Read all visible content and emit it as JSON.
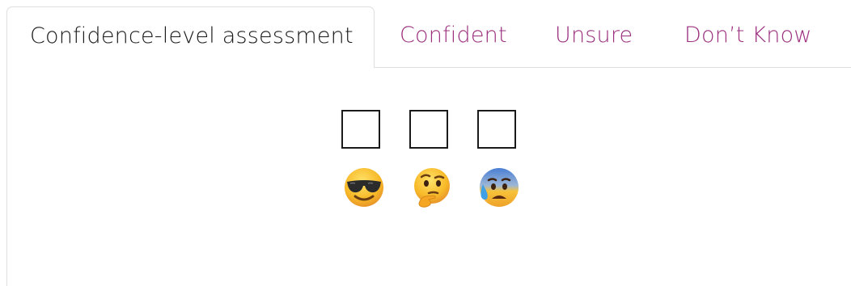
{
  "tabs": {
    "active": "Confidence-level assessment",
    "confident": "Confident",
    "unsure": "Unsure",
    "dont_know": "Don’t Know"
  },
  "options": [
    {
      "key": "confident",
      "checked": false,
      "icon": "smiling-face-with-sunglasses-icon"
    },
    {
      "key": "unsure",
      "checked": false,
      "icon": "thinking-face-icon"
    },
    {
      "key": "dont_know",
      "checked": false,
      "icon": "anxious-face-with-sweat-icon"
    }
  ],
  "colors": {
    "tab_link": "#9c2f7e",
    "tab_border": "#dedede",
    "text": "#1a1a1a",
    "emoji_yellow": "#f7b928",
    "emoji_blue": "#4a7fd4",
    "sweat_drop": "#3fa0e6"
  }
}
